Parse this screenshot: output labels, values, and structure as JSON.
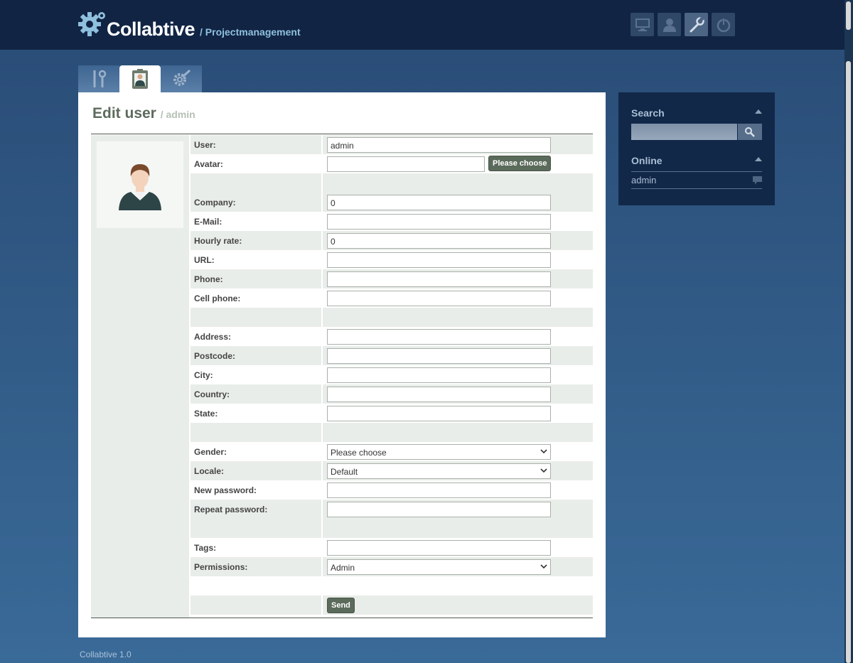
{
  "app": {
    "name": "Collabtive",
    "subtitle": "/ Projectmanagement",
    "footer": "Collabtive 1.0"
  },
  "top_icons": [
    {
      "name": "desktop-icon",
      "active": false
    },
    {
      "name": "user-icon",
      "active": false
    },
    {
      "name": "wrench-icon",
      "active": true
    },
    {
      "name": "power-icon",
      "active": false
    }
  ],
  "tabs": [
    {
      "name": "tools-icon",
      "active": false
    },
    {
      "name": "user-badge-icon",
      "active": true
    },
    {
      "name": "settings-gear-icon",
      "active": false
    }
  ],
  "page": {
    "title": "Edit user",
    "subtitle": "/ admin"
  },
  "form": {
    "user_label": "User:",
    "user_value": "admin",
    "avatar_label": "Avatar:",
    "avatar_value": "",
    "avatar_button": "Please choose",
    "company_label": "Company:",
    "company_value": "0",
    "email_label": "E-Mail:",
    "email_value": "",
    "hourly_label": "Hourly rate:",
    "hourly_value": "0",
    "url_label": "URL:",
    "url_value": "",
    "phone_label": "Phone:",
    "phone_value": "",
    "cell_label": "Cell phone:",
    "cell_value": "",
    "address_label": "Address:",
    "address_value": "",
    "postcode_label": "Postcode:",
    "postcode_value": "",
    "city_label": "City:",
    "city_value": "",
    "country_label": "Country:",
    "country_value": "",
    "state_label": "State:",
    "state_value": "",
    "gender_label": "Gender:",
    "gender_selected": "Please choose",
    "locale_label": "Locale:",
    "locale_selected": "Default",
    "newpass_label": "New password:",
    "newpass_value": "",
    "repeatpass_label": "Repeat password:",
    "repeatpass_value": "",
    "tags_label": "Tags:",
    "tags_value": "",
    "permissions_label": "Permissions:",
    "permissions_selected": "Admin",
    "send_button": "Send"
  },
  "sidebar": {
    "search_heading": "Search",
    "search_value": "",
    "online_heading": "Online",
    "online_users": [
      "admin"
    ]
  }
}
